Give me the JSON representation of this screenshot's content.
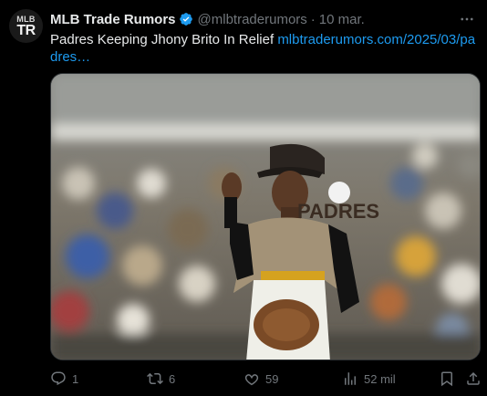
{
  "tweet": {
    "author_name": "MLB Trade Rumors",
    "avatar_line1": "MLB",
    "avatar_line2": "TR",
    "handle": "@mlbtraderumors",
    "separator": "·",
    "date": "10 mar.",
    "text": "Padres Keeping Jhony Brito In Relief ",
    "link": "mlbtraderumors.com/2025/03/padres…"
  },
  "media": {
    "alt": "Padres pitcher in camouflage jersey holding a glove",
    "jersey_text": "PADRES"
  },
  "actions": {
    "replies": "1",
    "reposts": "6",
    "likes": "59",
    "views": "52 mil"
  },
  "colors": {
    "background": "#000000",
    "text": "#e7e9ea",
    "muted": "#71767b",
    "link": "#1d9bf0",
    "verified": "#1d9bf0"
  }
}
